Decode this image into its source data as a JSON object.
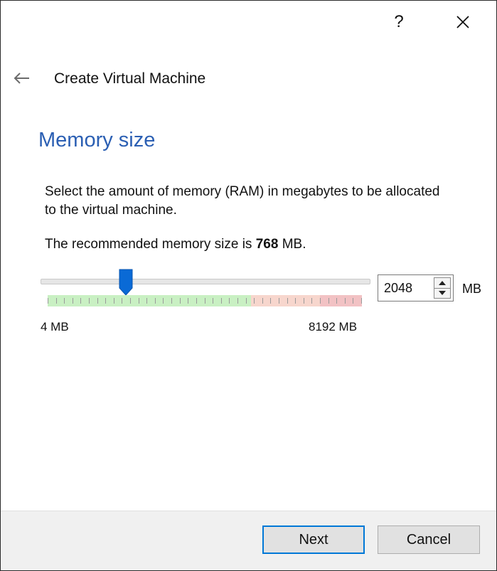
{
  "titlebar": {
    "help_label": "?",
    "close_icon": "close-icon"
  },
  "header": {
    "back_icon": "arrow-left-icon",
    "title": "Create Virtual Machine"
  },
  "page": {
    "heading": "Memory size",
    "description": "Select the amount of memory (RAM) in megabytes to be allocated to the virtual machine.",
    "recommend_prefix": "The recommended memory size is ",
    "recommend_value": "768",
    "recommend_suffix": " MB."
  },
  "memory": {
    "value": "2048",
    "unit": "MB",
    "min_label": "4 MB",
    "max_label": "8192 MB",
    "slider_min": 4,
    "slider_max": 8192,
    "slider_value": 2048
  },
  "footer": {
    "next_label": "Next",
    "cancel_label": "Cancel"
  },
  "colors": {
    "heading": "#2b5fb3",
    "scale_green": "#c9f0c3",
    "scale_amber": "#f7d6cd",
    "scale_red": "#f2c2c4",
    "slider_handle": "#0a6ad6",
    "default_button_border": "#0078d7"
  }
}
